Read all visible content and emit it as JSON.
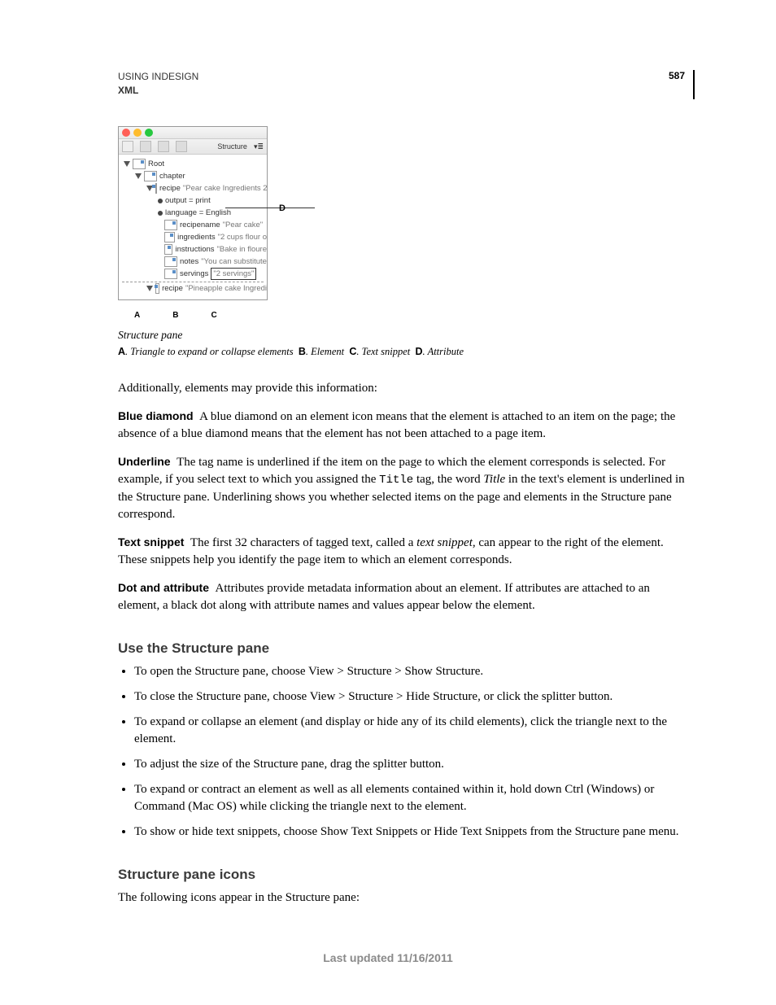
{
  "header": {
    "title": "USING INDESIGN",
    "section": "XML",
    "page_number": "587"
  },
  "figure": {
    "toolbar_label": "Structure",
    "root": "Root",
    "chapter": "chapter",
    "recipe1": "recipe",
    "recipe1_snip": "\"Pear cake Ingredients 2",
    "attr1": "output = print",
    "attr2": "language = English",
    "recipename": "recipename",
    "recipename_snip": "\"Pear cake\"",
    "ingredients": "ingredients",
    "ingredients_snip": "\"2 cups flour o",
    "instructions": "instructions",
    "instructions_snip": "\"Bake in floure",
    "notes": "notes",
    "notes_snip": "\"You can substitute",
    "servings": "servings",
    "servings_snip": "\"2 servings\"",
    "recipe2": "recipe",
    "recipe2_snip": "\"Pineapple cake Ingredi",
    "callout_a": "A",
    "callout_b": "B",
    "callout_c": "C",
    "callout_d": "D",
    "caption": "Structure pane",
    "legend_a": "Triangle to expand or collapse elements",
    "legend_b": "Element",
    "legend_c": "Text snippet",
    "legend_d": "Attribute"
  },
  "intro_line": "Additionally, elements may provide this information:",
  "definitions": {
    "blue_diamond_term": "Blue diamond",
    "blue_diamond_body": "A blue diamond on an element icon means that the element is attached to an item on the page; the absence of a blue diamond means that the element has not been attached to a page item.",
    "underline_term": "Underline",
    "underline_a": "The tag name is underlined if the item on the page to which the element corresponds is selected. For example, if you select text to which you assigned the ",
    "underline_code": "Title",
    "underline_b": " tag, the word ",
    "underline_italic": "Title",
    "underline_c": " in the text's element is underlined in the Structure pane. Underlining shows you whether selected items on the page and elements in the Structure pane correspond.",
    "snippet_term": "Text snippet",
    "snippet_a": "The first 32 characters of tagged text, called a ",
    "snippet_italic": "text snippet,",
    "snippet_b": " can appear to the right of the element. These snippets help you identify the page item to which an element corresponds.",
    "dot_term": "Dot and attribute",
    "dot_body": "Attributes provide metadata information about an element. If attributes are attached to an element, a black dot along with attribute names and values appear below the element."
  },
  "section1": {
    "heading": "Use the Structure pane",
    "items": [
      "To open the Structure pane, choose View > Structure > Show Structure.",
      "To close the Structure pane, choose View > Structure > Hide Structure, or click the splitter button.",
      "To expand or collapse an element (and display or hide any of its child elements), click the triangle next to the element.",
      "To adjust the size of the Structure pane, drag the splitter button.",
      "To expand or contract an element as well as all elements contained within it, hold down Ctrl (Windows) or Command (Mac OS) while clicking the triangle next to the element.",
      "To show or hide text snippets, choose Show Text Snippets or Hide Text Snippets from the Structure pane menu."
    ]
  },
  "section2": {
    "heading": "Structure pane icons",
    "body": "The following icons appear in the Structure pane:"
  },
  "footer": "Last updated 11/16/2011"
}
